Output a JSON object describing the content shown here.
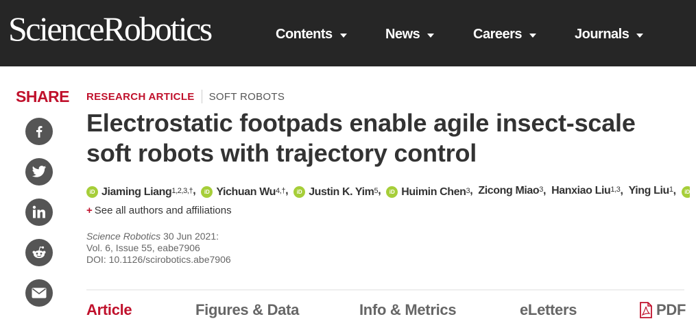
{
  "header": {
    "logo": "ScienceRobotics",
    "nav": [
      "Contents",
      "News",
      "Careers",
      "Journals"
    ]
  },
  "share": {
    "label": "SHARE",
    "icons": [
      "facebook-icon",
      "twitter-icon",
      "linkedin-icon",
      "reddit-icon",
      "email-icon"
    ]
  },
  "article": {
    "type": "RESEARCH ARTICLE",
    "category": "SOFT ROBOTS",
    "title": "Electrostatic footpads enable agile insect-scale soft robots with trajectory control",
    "authors": [
      {
        "name": "Jiaming Liang",
        "sup": "1,2,3,†",
        "orcid": true
      },
      {
        "name": "Yichuan Wu",
        "sup": "4,†",
        "orcid": true
      },
      {
        "name": "Justin K. Yim",
        "sup": "5",
        "orcid": true
      },
      {
        "name": "Huimin Chen",
        "sup": "3",
        "orcid": true
      },
      {
        "name": "Zicong Miao",
        "sup": "3",
        "orcid": false
      },
      {
        "name": "Hanxiao Liu",
        "sup": "1,3",
        "orcid": false
      },
      {
        "name": "Ying Liu",
        "sup": "1",
        "orcid": false
      }
    ],
    "authors_more": "…",
    "see_all": "See all authors and affiliations",
    "citation": {
      "journal": "Science Robotics",
      "date": "30 Jun 2021:",
      "volume": "Vol. 6, Issue 55, eabe7906",
      "doi": "DOI: 10.1126/scirobotics.abe7906"
    }
  },
  "tabs": [
    "Article",
    "Figures & Data",
    "Info & Metrics",
    "eLetters",
    "PDF"
  ],
  "colors": {
    "accent": "#c0112c",
    "header_bg": "#262626",
    "orcid": "#a6ce39",
    "share_icon_bg": "#555555"
  }
}
